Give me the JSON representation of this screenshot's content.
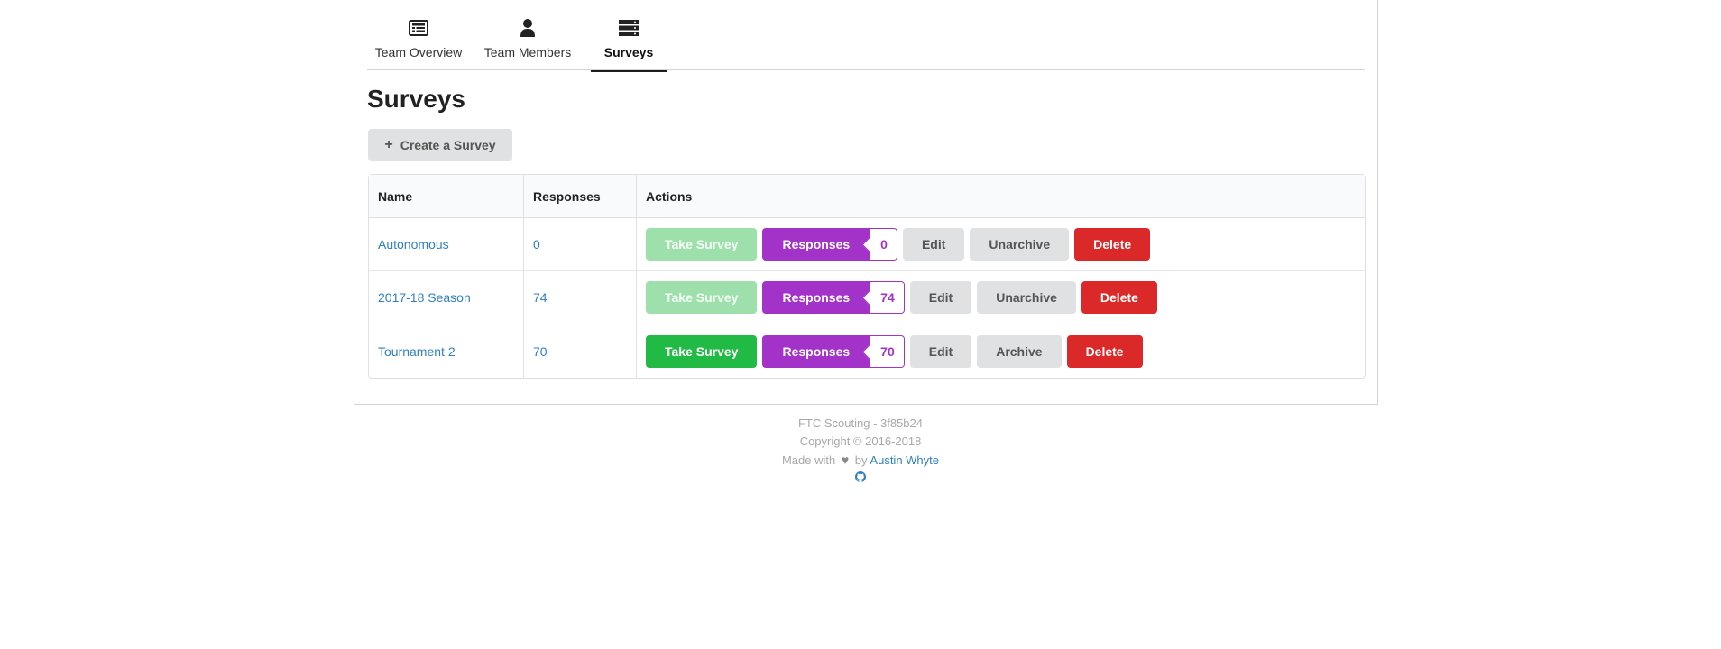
{
  "tabs": [
    {
      "label": "Team Overview",
      "icon": "newspaper-icon"
    },
    {
      "label": "Team Members",
      "icon": "user-icon"
    },
    {
      "label": "Surveys",
      "icon": "server-icon",
      "active": true
    }
  ],
  "page": {
    "title": "Surveys",
    "create_label": "Create a Survey"
  },
  "table": {
    "headers": [
      "Name",
      "Responses",
      "Actions"
    ],
    "rows": [
      {
        "name": "Autonomous",
        "responses": "0",
        "take": "Take Survey",
        "take_enabled": false,
        "resp_label": "Responses",
        "resp_count": "0",
        "edit": "Edit",
        "archive": "Unarchive",
        "delete": "Delete"
      },
      {
        "name": "2017-18 Season",
        "responses": "74",
        "take": "Take Survey",
        "take_enabled": false,
        "resp_label": "Responses",
        "resp_count": "74",
        "edit": "Edit",
        "archive": "Unarchive",
        "delete": "Delete"
      },
      {
        "name": "Tournament 2",
        "responses": "70",
        "take": "Take Survey",
        "take_enabled": true,
        "resp_label": "Responses",
        "resp_count": "70",
        "edit": "Edit",
        "archive": "Archive",
        "delete": "Delete"
      }
    ]
  },
  "footer": {
    "line1": "FTC Scouting - 3f85b24",
    "line2": "Copyright © 2016-2018",
    "made_with": "Made with",
    "by": "by",
    "author": "Austin Whyte",
    "github_icon": "github-icon"
  },
  "colors": {
    "take": "#21ba45",
    "take_disabled": "#9de0ac",
    "purple": "#a333c8",
    "red": "#db2828",
    "grey": "#e0e1e2",
    "link": "#2f7fc4"
  }
}
